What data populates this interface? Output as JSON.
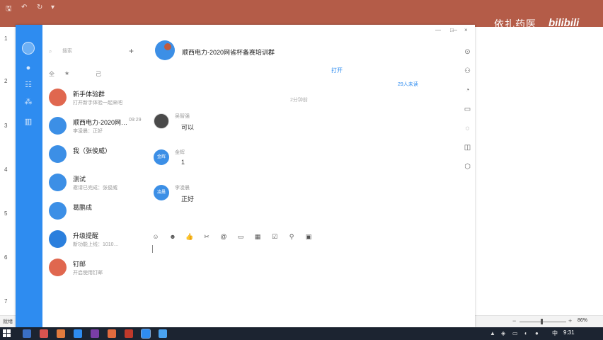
{
  "excel": {
    "ribbon_tabs": [
      "",
      "",
      "",
      "",
      "",
      "",
      "",
      "",
      "",
      "",
      "",
      "",
      "",
      ""
    ],
    "watermark_text": "依扎药医",
    "watermark_logo": "bilibili",
    "row_numbers": [
      "1",
      "2",
      "3",
      "4",
      "5",
      "6",
      "7"
    ],
    "status_left": "就绪",
    "zoom": "86%",
    "zoom_fraction": 0.5
  },
  "taskbar": {
    "time": "9:31",
    "ime": "中",
    "app_colors": [
      "#3a6fc4",
      "#d9534f",
      "#e27b3e",
      "#2e8cf0",
      "#7a3ea8",
      "#e26b3e",
      "#c0392b",
      "#2e8cf0",
      "#4aa3f0"
    ]
  },
  "window": {
    "controls": {
      "minimize": "—",
      "maximize": "□",
      "close": "×"
    }
  },
  "nav": {
    "icons": [
      "chat-icon",
      "contacts-icon",
      "apps-icon",
      "files-icon"
    ]
  },
  "conversations": {
    "search_placeholder": "搜索",
    "add_symbol": "+",
    "filters": [
      "全",
      "★",
      "",
      "己"
    ],
    "items": [
      {
        "name": "新手体验群",
        "sub": "打开新手体验一起来吧",
        "time": "",
        "avatar_text": "",
        "color": "red"
      },
      {
        "name": "顺西电力-2020网…",
        "sub": "李凌晨：正好",
        "time": "09:29",
        "avatar_text": "",
        "color": "blue"
      },
      {
        "name": "我（张俊威）",
        "sub": "",
        "time": "",
        "avatar_text": "",
        "color": "blue"
      },
      {
        "name": "测试",
        "sub": "邀请已完成：张俊威",
        "time": "",
        "avatar_text": "",
        "color": "blue"
      },
      {
        "name": "葛鹏成",
        "sub": "",
        "time": "",
        "avatar_text": "",
        "color": "blue"
      },
      {
        "name": "升级提醒",
        "sub": "新功能上线：1010…",
        "time": "",
        "avatar_text": "",
        "color": "blue-dark"
      },
      {
        "name": "钉邮",
        "sub": "开启使用钉邮",
        "time": "",
        "avatar_text": "",
        "color": "red"
      }
    ]
  },
  "chat": {
    "title": "顺西电力-2020网省杯备赛培训群",
    "open_label": "打开",
    "members_label": "29人未读",
    "time_divider": "2分钟前",
    "messages": [
      {
        "sender": "吴智强",
        "text": "可以",
        "avatar": "photo",
        "avatar_text": ""
      },
      {
        "sender": "金辉",
        "text": "1",
        "avatar": "blue",
        "avatar_text": "金辉"
      },
      {
        "sender": "李凌晨",
        "text": "正好",
        "avatar": "blue",
        "avatar_text": "凌晨"
      }
    ],
    "toolbar_icons": [
      "emoji-icon",
      "smile-icon",
      "like-icon",
      "scissors-icon",
      "mention-icon",
      "folder-icon",
      "calendar-icon",
      "check-icon",
      "pin-icon",
      "image-icon"
    ]
  },
  "right_sidebar": {
    "icons": [
      "more-icon",
      "add-member-icon",
      "chat-bubble-icon",
      "file-icon",
      "message-icon",
      "ding-icon",
      "settings-icon"
    ]
  }
}
